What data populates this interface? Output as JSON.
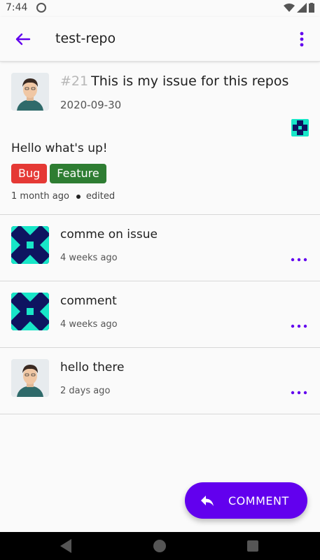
{
  "status_bar": {
    "time": "7:44"
  },
  "app_bar": {
    "title": "test-repo"
  },
  "issue": {
    "number": "#21",
    "title": "This is my issue for this repos",
    "date": "2020-09-30",
    "body": "Hello what's up!",
    "labels": [
      {
        "name": "Bug",
        "color": "#e53935"
      },
      {
        "name": "Feature",
        "color": "#2e7d32"
      }
    ],
    "created": "1 month ago",
    "edited": "edited"
  },
  "comments": [
    {
      "text": "comme on issue",
      "time": "4 weeks ago",
      "avatar": "identicon-avatar"
    },
    {
      "text": "comment",
      "time": "4 weeks ago",
      "avatar": "identicon-avatar"
    },
    {
      "text": "hello there",
      "time": "2 days ago",
      "avatar": "person-avatar"
    }
  ],
  "fab": {
    "label": "COMMENT",
    "icon": "reply-icon"
  },
  "colors": {
    "accent": "#6200ee",
    "identicon_bg": "#18e6c8",
    "identicon_fg": "#0e1460"
  }
}
